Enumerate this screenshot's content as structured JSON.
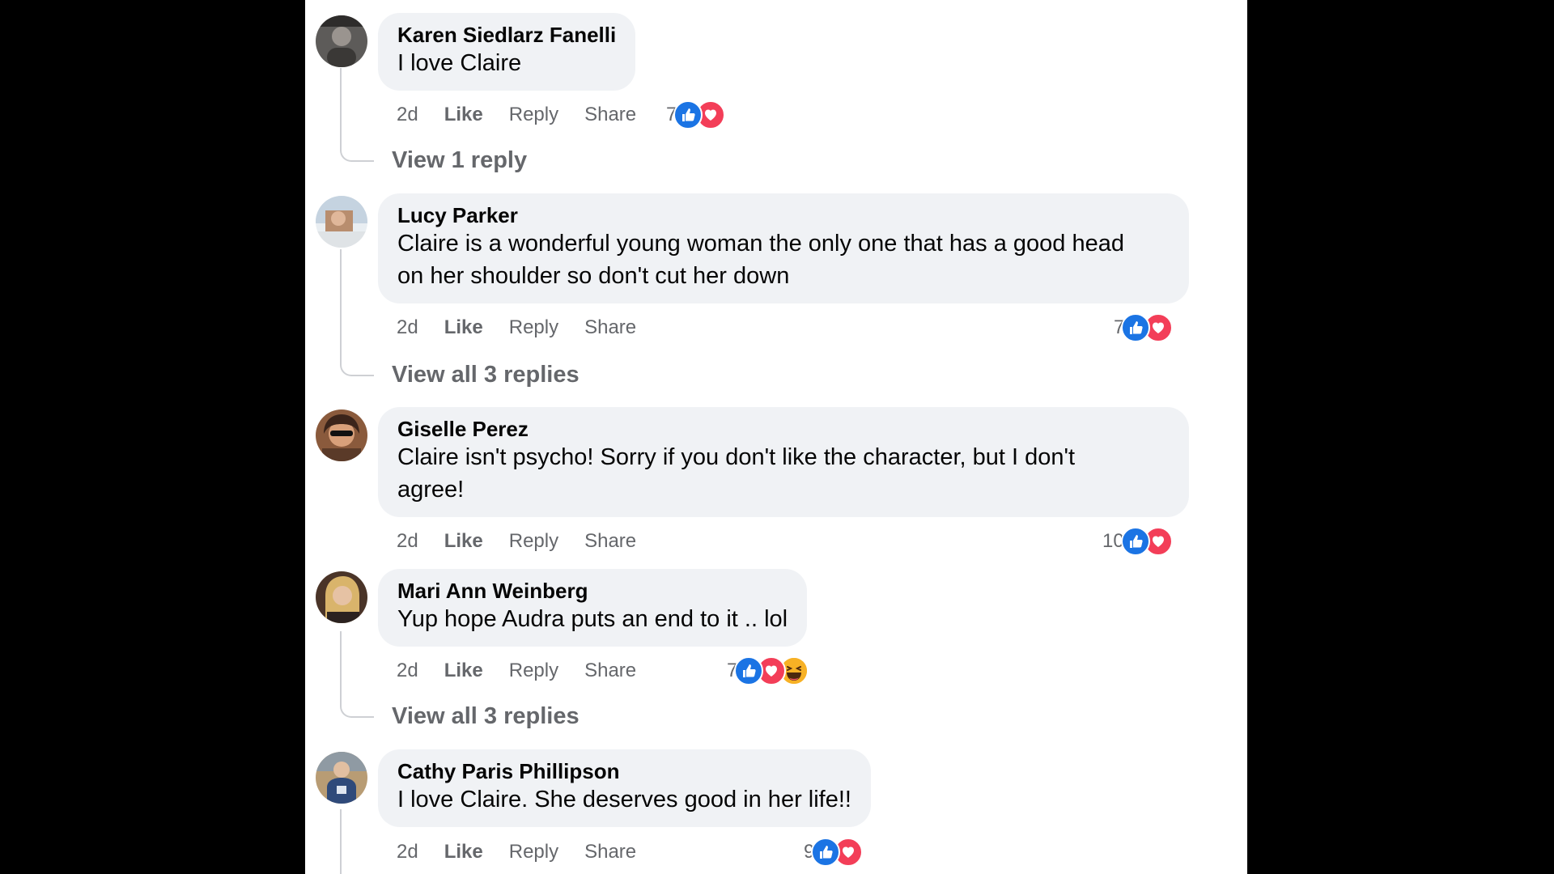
{
  "comments": [
    {
      "author": "Karen Siedlarz Fanelli",
      "text": "I love Claire",
      "time": "2d",
      "like": "Like",
      "reply": "Reply",
      "share": "Share",
      "reaction_count": "7",
      "reactions": [
        "like-icon",
        "love-icon"
      ],
      "view_replies": "View 1 reply"
    },
    {
      "author": "Lucy Parker",
      "text_lines": [
        "Claire is a wonderful young woman the only one that has a good head",
        "on her shoulder so don't cut her down"
      ],
      "time": "2d",
      "like": "Like",
      "reply": "Reply",
      "share": "Share",
      "reaction_count": "7",
      "reactions": [
        "like-icon",
        "love-icon"
      ],
      "view_replies": "View all 3 replies"
    },
    {
      "author": "Giselle Perez",
      "text_lines": [
        "Claire isn't psycho! Sorry if you don't like the character, but I don't",
        "agree!"
      ],
      "time": "2d",
      "like": "Like",
      "reply": "Reply",
      "share": "Share",
      "reaction_count": "10",
      "reactions": [
        "like-icon",
        "love-icon"
      ]
    },
    {
      "author": "Mari Ann Weinberg",
      "text": "Yup hope Audra puts an end to it .. lol",
      "time": "2d",
      "like": "Like",
      "reply": "Reply",
      "share": "Share",
      "reaction_count": "7",
      "reactions": [
        "like-icon",
        "love-icon",
        "haha-icon"
      ],
      "view_replies": "View all 3 replies"
    },
    {
      "author": "Cathy Paris Phillipson",
      "text": "I love Claire. She deserves good in her life!!",
      "time": "2d",
      "like": "Like",
      "reply": "Reply",
      "share": "Share",
      "reaction_count": "9",
      "reactions": [
        "like-icon",
        "love-icon"
      ]
    }
  ],
  "colors": {
    "like": "#1b74e4",
    "love": "#f33e58",
    "haha": "#f7b125",
    "bubble": "#f0f2f5",
    "muted": "#65676b"
  }
}
